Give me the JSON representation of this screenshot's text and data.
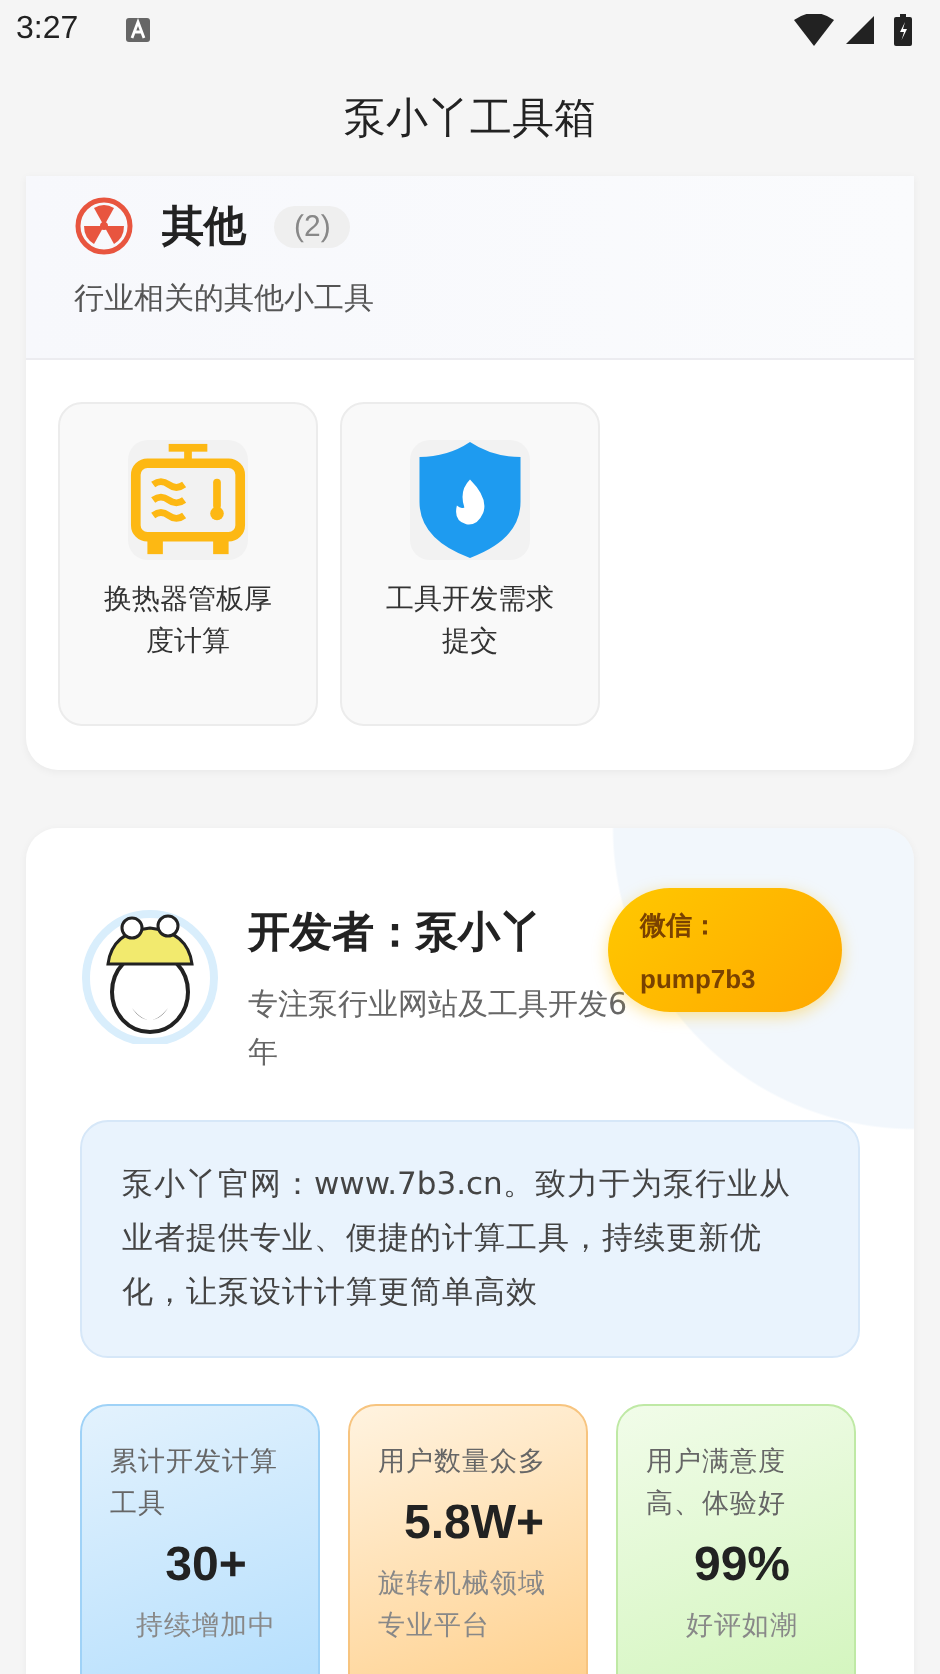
{
  "status_bar": {
    "time": "3:27"
  },
  "app_bar": {
    "title": "泵小丫工具箱"
  },
  "category": {
    "name": "其他",
    "count": "(2)",
    "description": "行业相关的其他小工具",
    "tools": [
      {
        "kind": "heat-exchanger",
        "label": "换热器管板厚度计算"
      },
      {
        "kind": "shield",
        "label": "工具开发需求提交"
      }
    ]
  },
  "developer": {
    "name": "开发者：泵小丫",
    "bio": "专注泵行业网站及工具开发6年",
    "wechat_label": "微信：",
    "wechat_id": "pump7b3",
    "about": "泵小丫官网：www.7b3.cn。致力于为泵行业从业者提供专业、便捷的计算工具，持续更新优化，让泵设计计算更简单高效",
    "stats": [
      {
        "kind": "blue",
        "caption": "累计开发计算工具",
        "value": "30+",
        "note": "持续增加中"
      },
      {
        "kind": "orange",
        "caption": "用户数量众多",
        "value": "5.8W+",
        "note": "旋转机械领域专业平台"
      },
      {
        "kind": "green",
        "caption": "用户满意度高、体验好",
        "value": "99%",
        "note": "好评如潮"
      }
    ]
  }
}
